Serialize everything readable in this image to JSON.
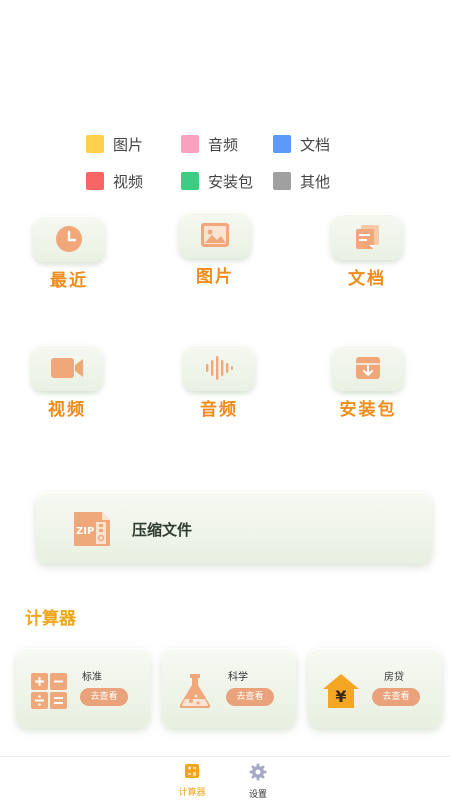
{
  "legend": [
    {
      "label": "图片",
      "color": "#ffd04c"
    },
    {
      "label": "音频",
      "color": "#f7a3c0"
    },
    {
      "label": "文档",
      "color": "#5b9bf7"
    },
    {
      "label": "视频",
      "color": "#f76565"
    },
    {
      "label": "安装包",
      "color": "#3ecb82"
    },
    {
      "label": "其他",
      "color": "#a0a0a0"
    }
  ],
  "categories": [
    {
      "label": "最近",
      "icon": "clock-icon"
    },
    {
      "label": "图片",
      "icon": "image-icon"
    },
    {
      "label": "文档",
      "icon": "document-icon"
    },
    {
      "label": "视频",
      "icon": "video-camera-icon"
    },
    {
      "label": "音频",
      "icon": "audio-wave-icon"
    },
    {
      "label": "安装包",
      "icon": "package-box-icon"
    }
  ],
  "compress": {
    "label": "压缩文件",
    "icon_text": "ZIP"
  },
  "calculator": {
    "title": "计算器",
    "items": [
      {
        "name": "标准",
        "button": "去查看",
        "icon": "calculator-icon"
      },
      {
        "name": "科学",
        "button": "去查看",
        "icon": "flask-icon"
      },
      {
        "name": "房贷",
        "button": "去查看",
        "icon": "house-yen-icon",
        "glyph": "¥"
      }
    ]
  },
  "nav": {
    "items": [
      {
        "label": "计算器",
        "icon": "calculator-tab-icon",
        "active": true
      },
      {
        "label": "设置",
        "icon": "gear-icon",
        "active": false
      }
    ],
    "active_color": "#f0a51a"
  }
}
